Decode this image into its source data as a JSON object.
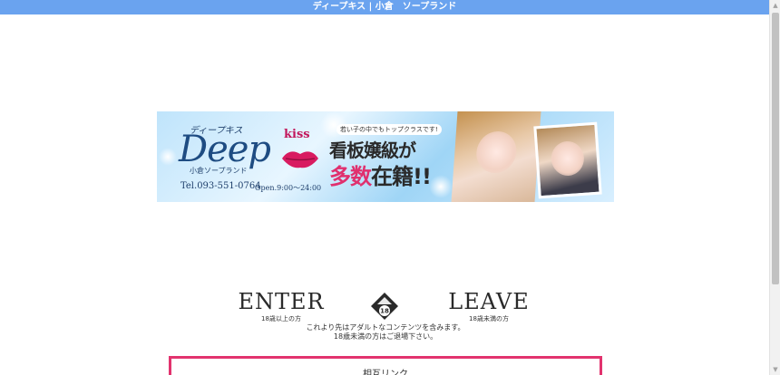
{
  "header": {
    "title": "ディープキス | 小倉　ソープランド"
  },
  "banner": {
    "logo_kana": "ディープキス",
    "logo_main": "Deep",
    "logo_kiss": "kiss",
    "genre": "小倉ソープランド",
    "tel": "Tel.093-551-0764",
    "hours": "Open.9:00〜24:00",
    "catch_sub": "若い子の中でもトップクラスです!",
    "catch_line1": "看板嬢級が",
    "catch_line2_part1": "多数",
    "catch_line2_part2": "在籍!!"
  },
  "entry": {
    "enter_label": "ENTER",
    "enter_sub": "18歳以上の方",
    "leave_label": "LEAVE",
    "leave_sub": "18歳未満の方",
    "badge_number": "18"
  },
  "notice": {
    "line1": "これより先はアダルトなコンテンツを含みます。",
    "line2": "18歳未満の方はご退場下さい。"
  },
  "links": {
    "title": "相互リンク"
  },
  "colors": {
    "header_bg": "#6aa3ef",
    "links_border": "#e2336e",
    "brand_blue": "#1e4c82",
    "brand_pink": "#e0306e"
  }
}
